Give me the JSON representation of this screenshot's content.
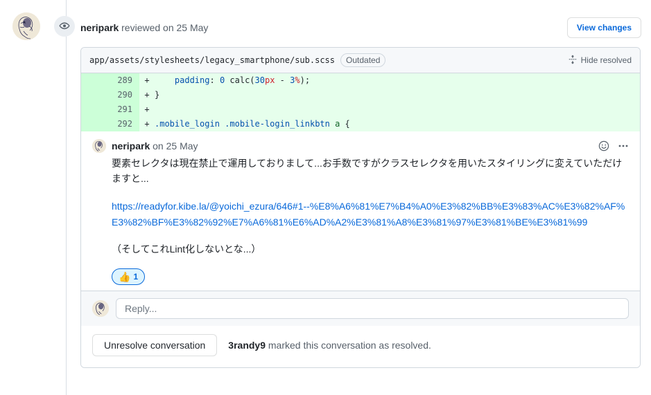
{
  "review": {
    "author": "neripark",
    "action_text": " reviewed on 25 May",
    "view_changes_label": "View changes",
    "eye_icon": "eye-icon"
  },
  "file": {
    "path": "app/assets/stylesheets/legacy_smartphone/sub.scss",
    "badge": "Outdated",
    "hide_resolved_label": "Hide resolved",
    "fold_icon": "fold-icon"
  },
  "diff": {
    "rows": [
      {
        "line": "289",
        "marker": "+",
        "tokens": [
          {
            "t": "    ",
            "c": "t-punc"
          },
          {
            "t": "padding",
            "c": "t-prop"
          },
          {
            "t": ": ",
            "c": "t-punc"
          },
          {
            "t": "0",
            "c": "t-num"
          },
          {
            "t": " calc(",
            "c": "t-punc"
          },
          {
            "t": "30",
            "c": "t-num"
          },
          {
            "t": "px",
            "c": "t-unit"
          },
          {
            "t": " - ",
            "c": "t-punc"
          },
          {
            "t": "3",
            "c": "t-num"
          },
          {
            "t": "%",
            "c": "t-unit"
          },
          {
            "t": ");",
            "c": "t-punc"
          }
        ]
      },
      {
        "line": "290",
        "marker": "+",
        "tokens": [
          {
            "t": "}",
            "c": "t-punc"
          }
        ]
      },
      {
        "line": "291",
        "marker": "+",
        "tokens": [
          {
            "t": "",
            "c": "t-punc"
          }
        ]
      },
      {
        "line": "292",
        "marker": "+",
        "tokens": [
          {
            "t": ".mobile_login .mobile-login_linkbtn ",
            "c": "t-sel"
          },
          {
            "t": "a",
            "c": "t-tag"
          },
          {
            "t": " {",
            "c": "t-punc"
          }
        ]
      }
    ]
  },
  "comment": {
    "author": "neripark",
    "timestamp": " on 25 May",
    "body_paragraph": "要素セレクタは現在禁止で運用しておりまして...お手数ですがクラスセレクタを用いたスタイリングに変えていただけますと...",
    "link_text": "https://readyfor.kibe.la/@yoichi_ezura/646#1--%E8%A6%81%E7%B4%A0%E3%82%BB%E3%83%AC%E3%82%AF%E3%82%BF%E3%82%92%E7%A6%81%E6%AD%A2%E3%81%A8%E3%81%97%E3%81%BE%E3%81%99",
    "note_paragraph": "（そしてこれLint化しないとな...）",
    "emoji_button_icon": "smiley-icon",
    "kebab_icon": "kebab-menu-icon",
    "reaction": {
      "emoji": "👍",
      "count": "1"
    }
  },
  "reply": {
    "placeholder": "Reply..."
  },
  "resolve": {
    "button_label": "Unresolve conversation",
    "actor": "3randy9",
    "message": " marked this conversation as resolved."
  }
}
